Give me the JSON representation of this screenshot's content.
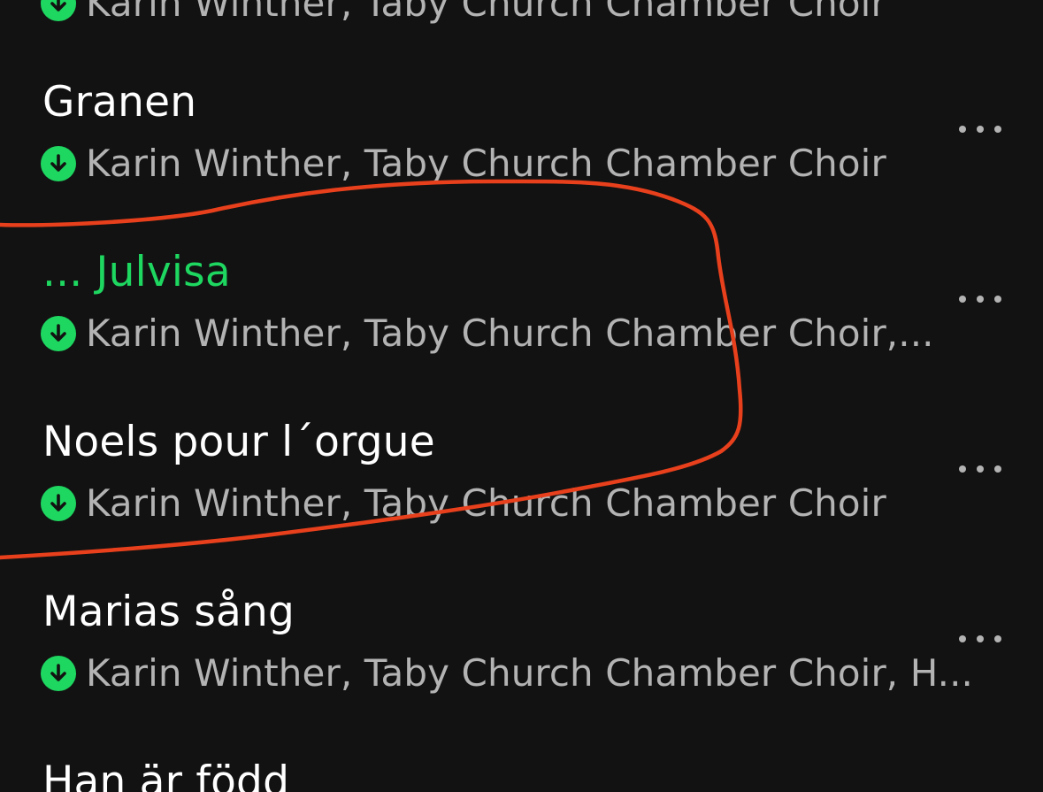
{
  "tracks": [
    {
      "title": "",
      "artists": "Karin Winther, Taby Church Chamber Choir",
      "playing": false,
      "downloaded": true
    },
    {
      "title": "Granen",
      "artists": "Karin Winther, Taby Church Chamber Choir",
      "playing": false,
      "downloaded": true
    },
    {
      "title": "... Julvisa",
      "artists": "Karin Winther, Taby Church Chamber Choir,...",
      "playing": true,
      "downloaded": true
    },
    {
      "title": "Noels pour l´orgue",
      "artists": "Karin Winther, Taby Church Chamber Choir",
      "playing": false,
      "downloaded": true
    },
    {
      "title": "Marias sång",
      "artists": "Karin Winther, Taby Church Chamber Choir, H...",
      "playing": false,
      "downloaded": true
    },
    {
      "title": "Han är född",
      "artists": "",
      "playing": false,
      "downloaded": false
    }
  ],
  "icons": {
    "downloaded": "download-arrow-icon",
    "more": "more-options-icon"
  },
  "colors": {
    "background": "#121212",
    "accent": "#1ed760",
    "primary_text": "#ffffff",
    "secondary_text": "#b3b3b3",
    "annotation_stroke": "#e8401c"
  }
}
